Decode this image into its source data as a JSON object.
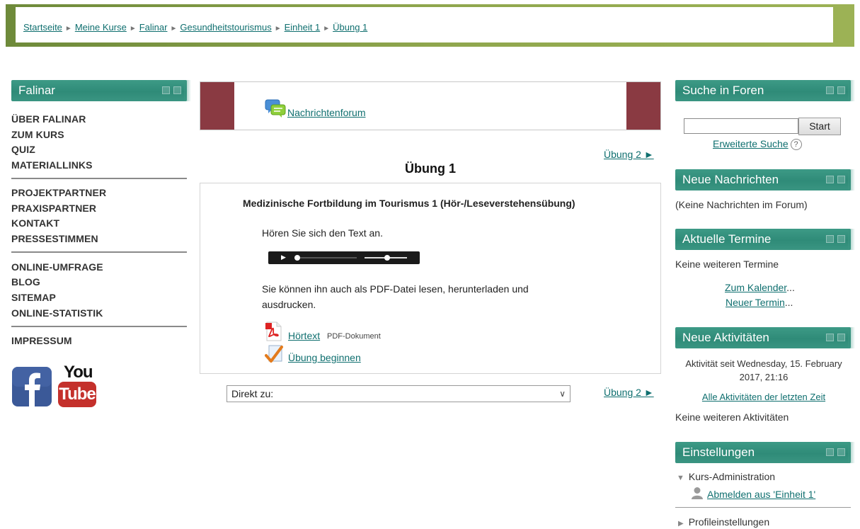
{
  "breadcrumb": {
    "items": [
      "Startseite",
      "Meine Kurse",
      "Falinar",
      "Gesundheitstourismus",
      "Einheit 1",
      "Übung 1"
    ]
  },
  "left": {
    "block_title": "Falinar",
    "group1": [
      "ÜBER FALINAR",
      "ZUM KURS",
      "QUIZ",
      "MATERIALLINKS"
    ],
    "group2": [
      "PROJEKTPARTNER",
      "PRAXISPARTNER",
      "KONTAKT",
      "PRESSESTIMMEN"
    ],
    "group3": [
      "ONLINE-UMFRAGE",
      "BLOG",
      "SITEMAP",
      "ONLINE-STATISTIK"
    ],
    "group4": [
      "IMPRESSUM"
    ],
    "social": {
      "facebook_icon": "facebook-icon",
      "youtube_top": "You",
      "youtube_bottom": "Tube"
    }
  },
  "center": {
    "forum_link": "Nachrichtenforum",
    "next_link": "Übung 2 ►",
    "page_title": "Übung 1",
    "section_heading": "Medizinische Fortbildung im Tourismus 1 (Hör-/Leseverstehensübung)",
    "intro": "Hören Sie sich den Text an.",
    "pdf_text_line1": "Sie können ihn auch als PDF-Datei lesen, herunterladen und",
    "pdf_text_line2": "ausdrucken.",
    "file_link": "Hörtext",
    "file_type": "PDF-Dokument",
    "quiz_link": "Übung beginnen",
    "jump_label": "Direkt zu:",
    "next_link_bottom": "Übung 2 ►"
  },
  "right": {
    "search": {
      "title": "Suche in Foren",
      "button": "Start",
      "advanced": "Erweiterte Suche",
      "help": "?"
    },
    "news": {
      "title": "Neue Nachrichten",
      "empty": "(Keine Nachrichten im Forum)"
    },
    "events": {
      "title": "Aktuelle Termine",
      "empty": "Keine weiteren Termine",
      "calendar_link": "Zum Kalender",
      "new_event_link": "Neuer Termin",
      "ellipsis": "..."
    },
    "activity": {
      "title": "Neue Aktivitäten",
      "since_line1": "Aktivität seit Wednesday, 15. February",
      "since_line2": "2017, 21:16",
      "all_link": "Alle Aktivitäten der letzten Zeit",
      "empty": "Keine weiteren Aktivitäten"
    },
    "settings": {
      "title": "Einstellungen",
      "course_admin": "Kurs-Administration",
      "unenrol": "Abmelden aus 'Einheit 1'",
      "profile": "Profileinstellungen"
    }
  },
  "colors": {
    "header_green": "#8fa64d",
    "block_teal": "#3a9582",
    "forum_maroon": "#8a3a42",
    "link": "#0f6f6f"
  }
}
